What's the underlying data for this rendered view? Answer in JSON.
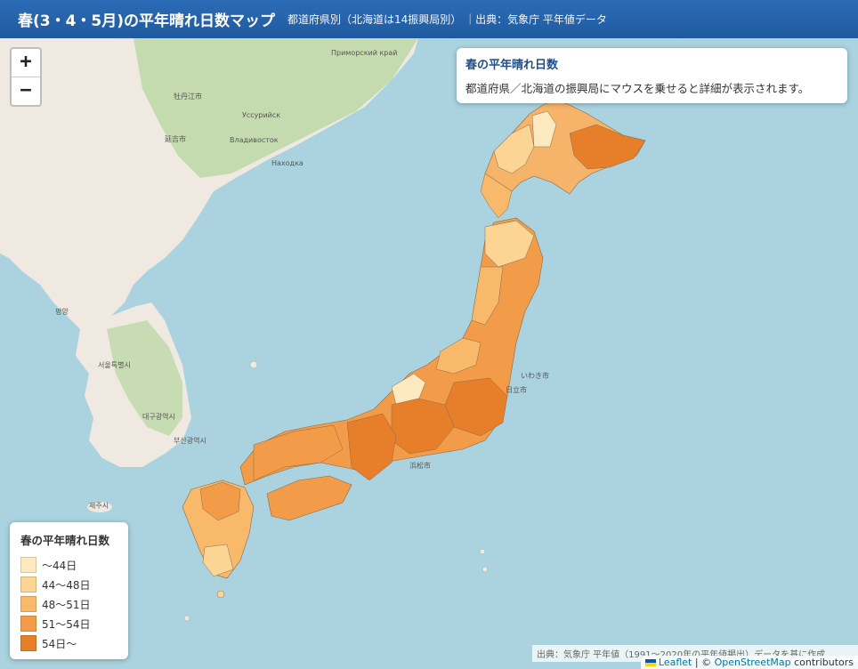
{
  "header": {
    "title": "春(3・4・5月)の平年晴れ日数マップ",
    "subtitle": "都道府県別（北海道は14振興局別） ｜出典：気象庁 平年値データ"
  },
  "zoom": {
    "in": "+",
    "out": "−"
  },
  "info": {
    "title": "春の平年晴れ日数",
    "description": "都道府県／北海道の振興局にマウスを乗せると詳細が表示されます。"
  },
  "legend": {
    "title": "春の平年晴れ日数",
    "items": [
      {
        "label": "〜44日",
        "color": "#fde9bf"
      },
      {
        "label": "44〜48日",
        "color": "#fcd494"
      },
      {
        "label": "48〜51日",
        "color": "#f9b96a"
      },
      {
        "label": "51〜54日",
        "color": "#f29c49"
      },
      {
        "label": "54日〜",
        "color": "#e77f2a"
      }
    ]
  },
  "source_note": "出典：気象庁 平年値（1991〜2020年の平年値掲出）データを基に作成",
  "attribution": {
    "leaflet": "Leaflet",
    "sep": " | © ",
    "osm": "OpenStreetMap",
    "contributors": " contributors"
  },
  "map_labels": {
    "vladivostok": "Владивосток",
    "yanji": "延吉市",
    "ussuriysk": "Уссурийск",
    "nakhodka": "Находка",
    "primorsky": "Приморский край",
    "pyongyang": "평양",
    "seoul": "서울특별시",
    "daegu": "대구광역시",
    "busan": "부산광역시",
    "jeju": "제주시",
    "nakhodka_alt": "牡丹江市",
    "hamamatsu": "浜松市",
    "iwaki": "いわき市",
    "hitachi": "日立市"
  },
  "colors": {
    "water": "#aad3df",
    "land": "#efe9e1",
    "forest": "#b9d7a3",
    "header": "#1f5aa0"
  }
}
